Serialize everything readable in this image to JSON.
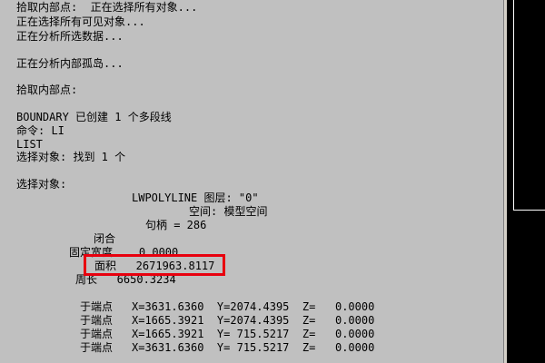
{
  "console": {
    "lines": [
      "拾取内部点:  正在选择所有对象...",
      "正在选择所有可见对象...",
      "正在分析所选数据...",
      "",
      "正在分析内部孤岛...",
      "",
      "拾取内部点:",
      "",
      "BOUNDARY 已创建 1 个多段线",
      "命令: LI",
      "LIST",
      "选择对象: 找到 1 个",
      "",
      "选择对象:"
    ],
    "entity_type_line": "LWPOLYLINE 图层: \"0\"",
    "space_line": "空间: 模型空间",
    "handle_line": "句柄 = 286",
    "closed_label": "闭合",
    "const_width_line": "固定宽度    0.0000",
    "area_line": "面积   2671963.8117",
    "perimeter_line": "周长   6650.3234",
    "vertex_label": "于端点",
    "vertices": [
      "X=3631.6360  Y=2074.4395  Z=   0.0000",
      "X=1665.3921  Y=2074.4395  Z=   0.0000",
      "X=1665.3921  Y= 715.5217  Z=   0.0000",
      "X=3631.6360  Y= 715.5217  Z=   0.0000"
    ]
  },
  "colors": {
    "console_background": "#c0c0c0",
    "text": "#000000",
    "highlight_box": "#e8000e",
    "side_panel": "#000000"
  }
}
